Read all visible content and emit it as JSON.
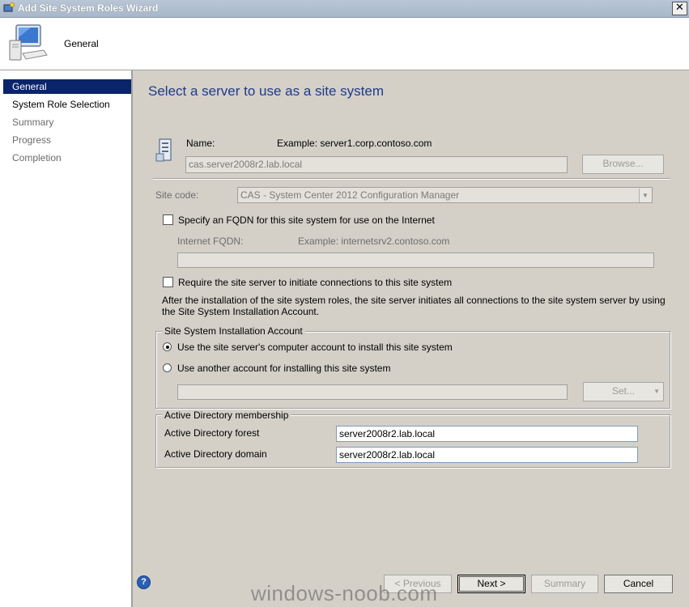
{
  "window": {
    "title": "Add Site System Roles Wizard",
    "close_glyph": "✕"
  },
  "header": {
    "title": "General"
  },
  "nav": {
    "items": [
      {
        "label": "General"
      },
      {
        "label": "System Role Selection"
      },
      {
        "label": "Summary"
      },
      {
        "label": "Progress"
      },
      {
        "label": "Completion"
      }
    ]
  },
  "main": {
    "title": "Select a server to use as a site system",
    "name_label": "Name:",
    "name_example": "Example: server1.corp.contoso.com",
    "name_value": "cas.server2008r2.lab.local",
    "browse_button": "Browse...",
    "site_code_label": "Site code:",
    "site_code_value": "CAS - System Center 2012 Configuration Manager",
    "fqdn_checkbox_label": "Specify an FQDN for this site system for use on the Internet",
    "internet_fqdn_label": "Internet FQDN:",
    "internet_fqdn_example": "Example: internetsrv2.contoso.com",
    "internet_fqdn_value": "",
    "require_checkbox_label": "Require the site server to initiate connections to this site system",
    "info_text": "After the  installation of the site system roles, the site server initiates all connections to the site system server by using the Site System Installation Account.",
    "install_account_group": "Site System Installation Account",
    "radio_computer_account": "Use the site server's computer account to install this site system",
    "radio_another_account": "Use another account for installing this site system",
    "account_value": "",
    "set_button": "Set...",
    "ad_group": "Active Directory membership",
    "ad_forest_label": "Active Directory forest",
    "ad_forest_value": "server2008r2.lab.local",
    "ad_domain_label": "Active Directory domain",
    "ad_domain_value": "server2008r2.lab.local"
  },
  "footer": {
    "previous": "< Previous",
    "next": "Next >",
    "summary": "Summary",
    "cancel": "Cancel",
    "help_glyph": "?"
  },
  "watermark": "windows-noob.com",
  "icons": [
    "wizard-icon",
    "computer-icon",
    "server-icon",
    "help-icon",
    "close-icon",
    "dropdown-arrow-icon"
  ],
  "colors": {
    "nav_active": "#0a246a",
    "title_blue": "#1f3a8a",
    "dialog_bg": "#d4d0c8"
  }
}
